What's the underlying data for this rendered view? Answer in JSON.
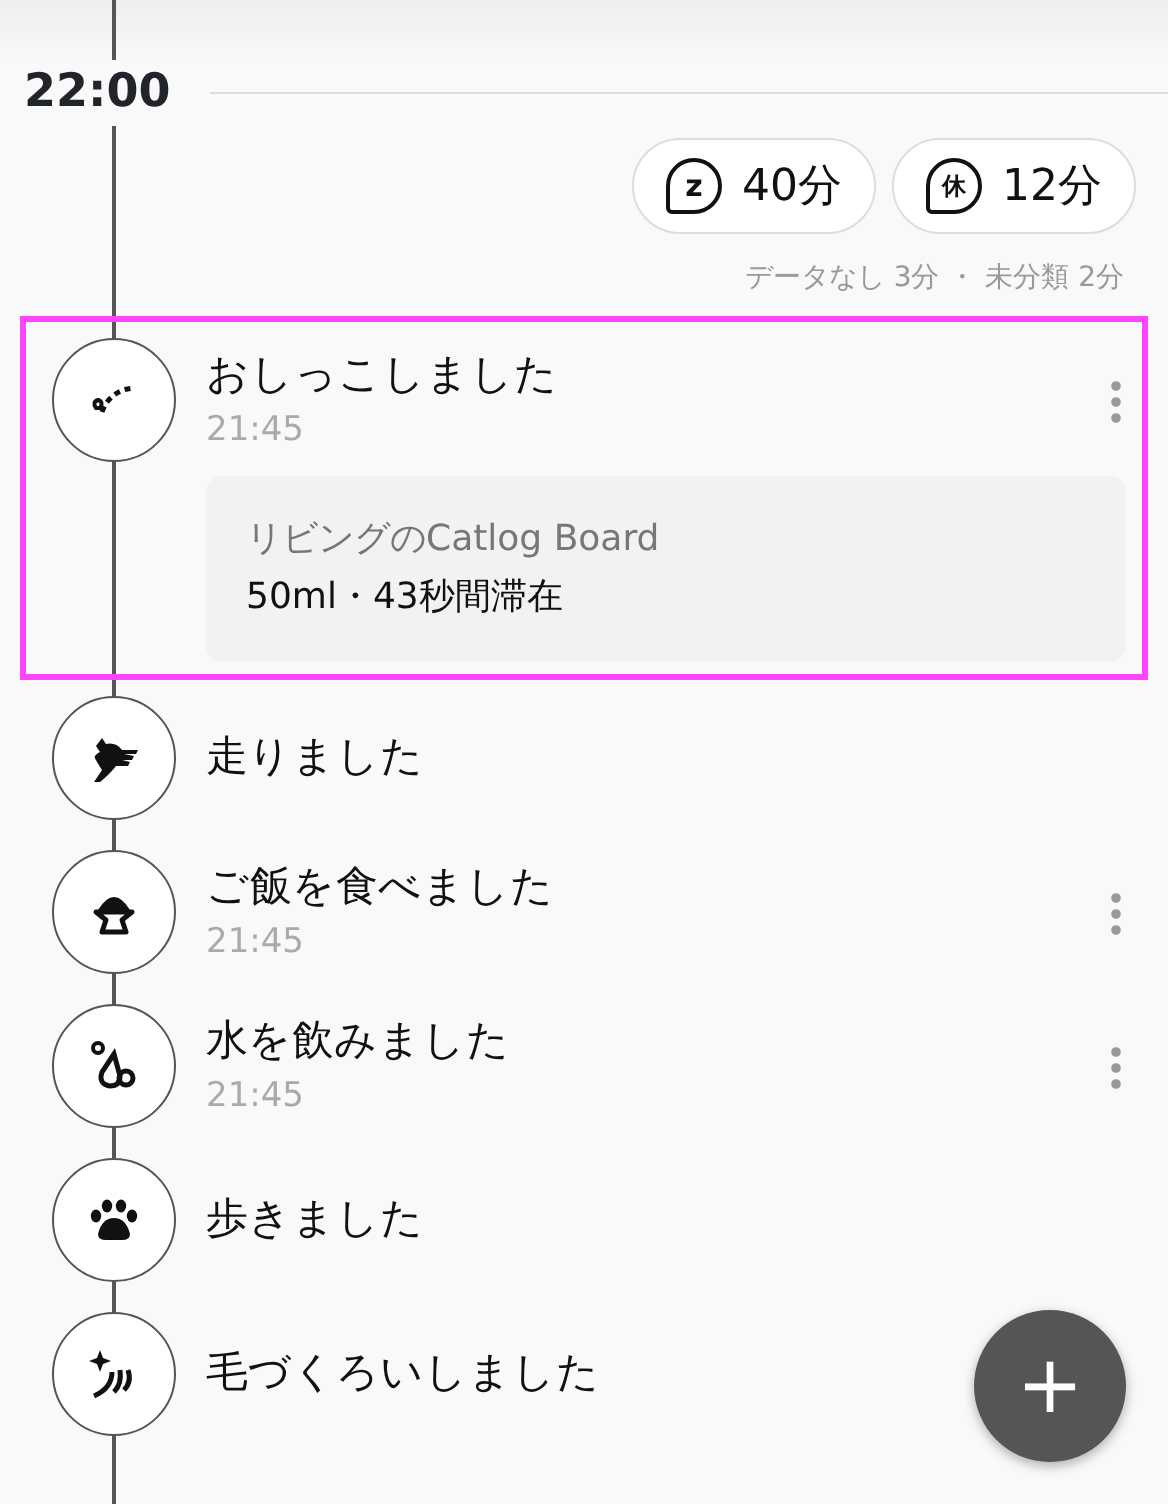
{
  "hour_label": "22:00",
  "summary_pills": [
    {
      "kind": "sleep",
      "icon_text": "z",
      "value": "40分"
    },
    {
      "kind": "rest",
      "icon_text": "休",
      "value": "12分"
    }
  ],
  "summary_note": "データなし 3分 ・ 未分類 2分",
  "events": [
    {
      "kind": "pee",
      "title": "おしっこしました",
      "time": "21:45",
      "selected": true,
      "has_menu": true,
      "detail": {
        "place": "リビングのCatlog Board",
        "info": "50ml・43秒間滞在"
      }
    },
    {
      "kind": "run",
      "title": "走りました",
      "selected": false,
      "has_menu": false
    },
    {
      "kind": "food",
      "title": "ご飯を食べました",
      "time": "21:45",
      "selected": false,
      "has_menu": true
    },
    {
      "kind": "water",
      "title": "水を飲みました",
      "time": "21:45",
      "selected": false,
      "has_menu": true
    },
    {
      "kind": "walk",
      "title": "歩きました",
      "selected": false,
      "has_menu": false
    },
    {
      "kind": "groom",
      "title": "毛づくろいしました",
      "selected": false,
      "has_menu": false
    }
  ],
  "fab": {
    "label": "+"
  }
}
